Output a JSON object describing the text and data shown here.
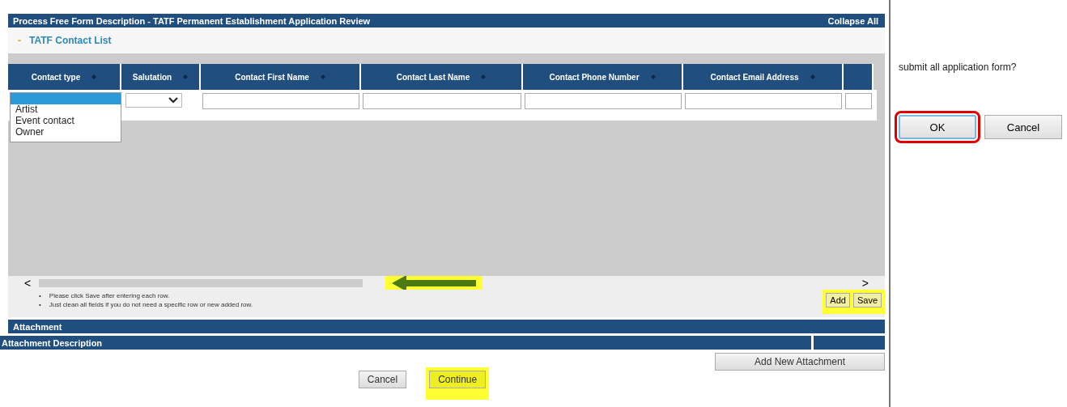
{
  "panel": {
    "title": "Process Free Form Description - TATF Permanent Establishment Application Review",
    "collapse_link": "Collapse All"
  },
  "section": {
    "toggle": "-",
    "title": "TATF Contact List",
    "expanded": true
  },
  "table": {
    "columns": [
      {
        "label": "Contact type",
        "sortable": true
      },
      {
        "label": "Salutation",
        "sortable": true
      },
      {
        "label": "Contact First Name",
        "sortable": true
      },
      {
        "label": "Contact Last Name",
        "sortable": true
      },
      {
        "label": "Contact Phone Number",
        "sortable": true
      },
      {
        "label": "Contact Email Address",
        "sortable": true
      }
    ],
    "contact_type_list": {
      "blank_selected": true,
      "options": [
        {
          "label": "Artist",
          "selected": false
        },
        {
          "label": "Event contact",
          "selected": false
        },
        {
          "label": "Owner",
          "selected": false
        }
      ]
    }
  },
  "scroll": {
    "left": "<",
    "right": ">"
  },
  "notes": [
    {
      "bullet": "•",
      "text": "Please click Save after entering each row."
    },
    {
      "bullet": "•",
      "text": "Just clean all fields if you do not need a specific row or new added row."
    }
  ],
  "row_buttons": [
    {
      "label": "Add",
      "highlighted": true
    },
    {
      "label": "Save",
      "highlighted": true
    }
  ],
  "attachment": {
    "title": "Attachment",
    "description_header": "Attachment Description",
    "add_button": "Add New Attachment"
  },
  "footer_buttons": [
    {
      "label": "Cancel",
      "highlighted": false
    },
    {
      "label": "Continue",
      "highlighted": true
    }
  ],
  "dialog": {
    "message": "submit all application form?",
    "buttons": [
      {
        "label": "OK",
        "selected": true
      },
      {
        "label": "Cancel",
        "selected": false
      }
    ]
  }
}
